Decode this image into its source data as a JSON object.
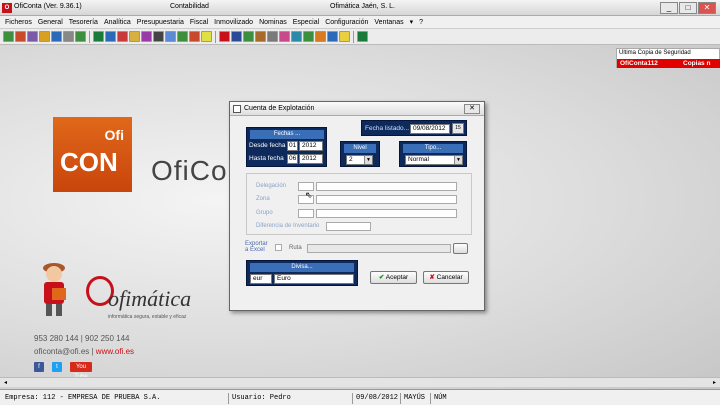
{
  "window": {
    "title": "OfiConta (Ver. 9.36.1)",
    "module": "Contabilidad",
    "company": "Ofimática Jaén, S. L.",
    "minimize": "_",
    "maximize": "□",
    "close": "✕"
  },
  "menu": [
    "Ficheros",
    "General",
    "Tesorería",
    "Analítica",
    "Presupuestaria",
    "Fiscal",
    "Inmovilizado",
    "Nominas",
    "Especial",
    "Configuración",
    "Ventanas",
    "▾",
    "?"
  ],
  "backup": {
    "title": "Ultima Copia de Seguridad",
    "name": "OfiConta112",
    "copies": "Copias n"
  },
  "brand": {
    "logo_ofi": "Ofi",
    "logo_con": "CON",
    "product": "OfiCo",
    "company": "ofimática",
    "tagline": "informática segura, estable y eficaz",
    "phones": "953 280 144  |  902 250 144",
    "email": "oficonta@ofi.es",
    "separator": " | ",
    "web": "www.ofi.es",
    "facebook": "f",
    "twitter": "t",
    "youtube": "You Tube"
  },
  "scroll": {
    "left": "◂",
    "right": "▸"
  },
  "status": {
    "company": "Empresa: 112 - EMPRESA DE PRUEBA S.A.",
    "user": "Usuario: Pedro",
    "date": "09/08/2012",
    "caps": "MAYÚS",
    "num": "NÚM"
  },
  "dialog": {
    "title": "Cuenta de Explotación",
    "close": "✕",
    "fecha_listado_label": "Fecha listado...",
    "fecha_listado": "09/08/2012",
    "calendar": "15",
    "fechas_header": "Fechas ...",
    "desde_label": "Desde fecha",
    "desde_month": "01",
    "desde_year": "2012",
    "hasta_label": "Hasta fecha",
    "hasta_month": "06",
    "hasta_year": "2012",
    "nivel_header": "Nivel",
    "nivel": "2",
    "tipo_header": "Tipo...",
    "tipo": "Normal",
    "delegacion": "Delegación",
    "zona": "Zona",
    "grupo": "Grupo",
    "diferencia": "Diferencia de Inventario",
    "exportar": "Exportar\na Excel",
    "ruta": "Ruta",
    "divisa_header": "Divisa...",
    "divisa_code": "eur",
    "divisa_name": "Euro",
    "aceptar": "Aceptar",
    "cancelar": "Cancelar"
  }
}
